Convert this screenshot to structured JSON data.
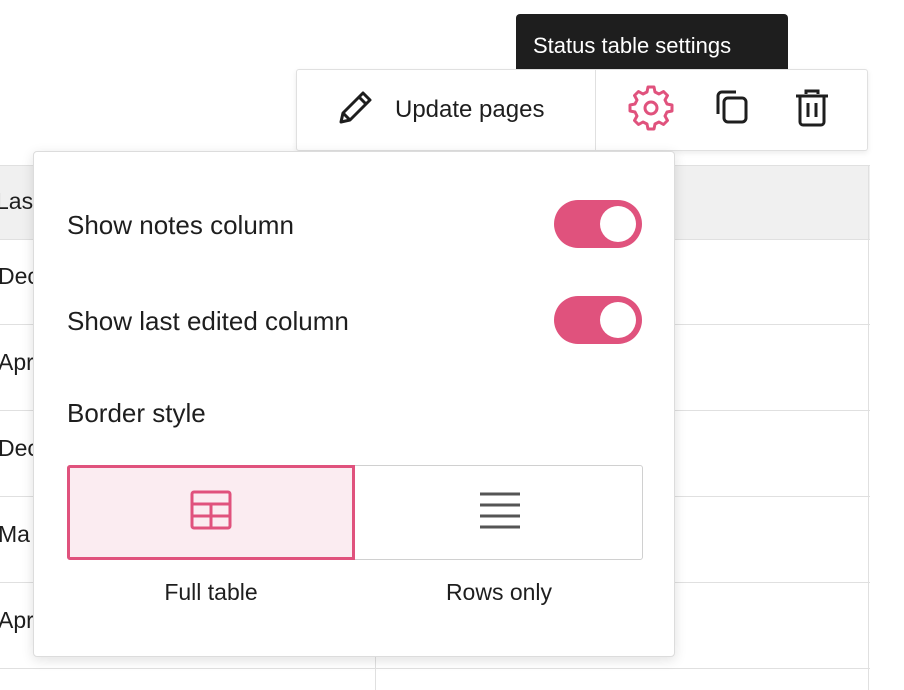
{
  "tooltip": {
    "text": "Status table settings"
  },
  "toolbar": {
    "update_label": "Update pages",
    "update_icon": "pencil-icon",
    "settings_icon": "gear-icon",
    "duplicate_icon": "duplicate-icon",
    "delete_icon": "trash-icon"
  },
  "background_table": {
    "header_fragment": "Las",
    "row_fragments": [
      "Dec",
      "Apr",
      "Dec",
      "Ma",
      "Apr"
    ]
  },
  "popover": {
    "show_notes_label": "Show notes column",
    "show_notes_on": true,
    "show_last_edited_label": "Show last edited column",
    "show_last_edited_on": true,
    "border_style_label": "Border style",
    "options": [
      {
        "label": "Full table",
        "icon": "table-grid-icon",
        "selected": true
      },
      {
        "label": "Rows only",
        "icon": "rows-lines-icon",
        "selected": false
      }
    ]
  },
  "colors": {
    "accent": "#e0527d",
    "accent_light": "#fbecf1",
    "tooltip_bg": "#1e1e1e",
    "text": "#1e1e1e",
    "border": "#e0e0e0"
  }
}
